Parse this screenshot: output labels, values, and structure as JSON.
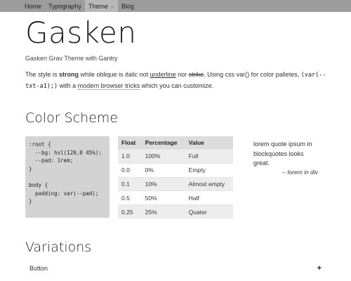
{
  "nav": {
    "items": [
      "Home",
      "Typography",
      "Theme",
      "Blog"
    ],
    "caret": "⌄"
  },
  "header": {
    "title": "Gasken",
    "subtitle": "Gasken Grav Theme with Gantry"
  },
  "intro": {
    "p1": "The style is ",
    "strong": "strong",
    "p2": " while oblique is ",
    "italic": "italic",
    "p3": " not ",
    "underline": "underline",
    "p4": " nor ",
    "strike": "strike",
    "p5": ". Using css var() for color palletes, ",
    "code": "(var(--txt-a1);)",
    "p6": " with a ",
    "link": "modern browser tricks",
    "p7": " which you can customize."
  },
  "color_scheme": {
    "heading": "Color Scheme",
    "code": ":root {\n  --bg: hsl(120,0 45%);\n  --pad: 1rem;\n}\n\nbody {\n  padding: var(--pad);\n}",
    "table": {
      "headers": [
        "Float",
        "Percentage",
        "Value"
      ],
      "rows": [
        [
          "1.0",
          "100%",
          "Full"
        ],
        [
          "0.0",
          "0%",
          "Empty"
        ],
        [
          "0.1",
          "10%",
          "Almost empty"
        ],
        [
          "0.5",
          "50%",
          "Half"
        ],
        [
          "0.25",
          "25%",
          "Quater"
        ]
      ]
    },
    "quote": "lorem quote ipsum in blockquotes looks great.",
    "quote_cite": "-- lorem in div"
  },
  "variations": {
    "heading": "Variations",
    "accordion_label": "Button",
    "accordion_icon": "+"
  }
}
